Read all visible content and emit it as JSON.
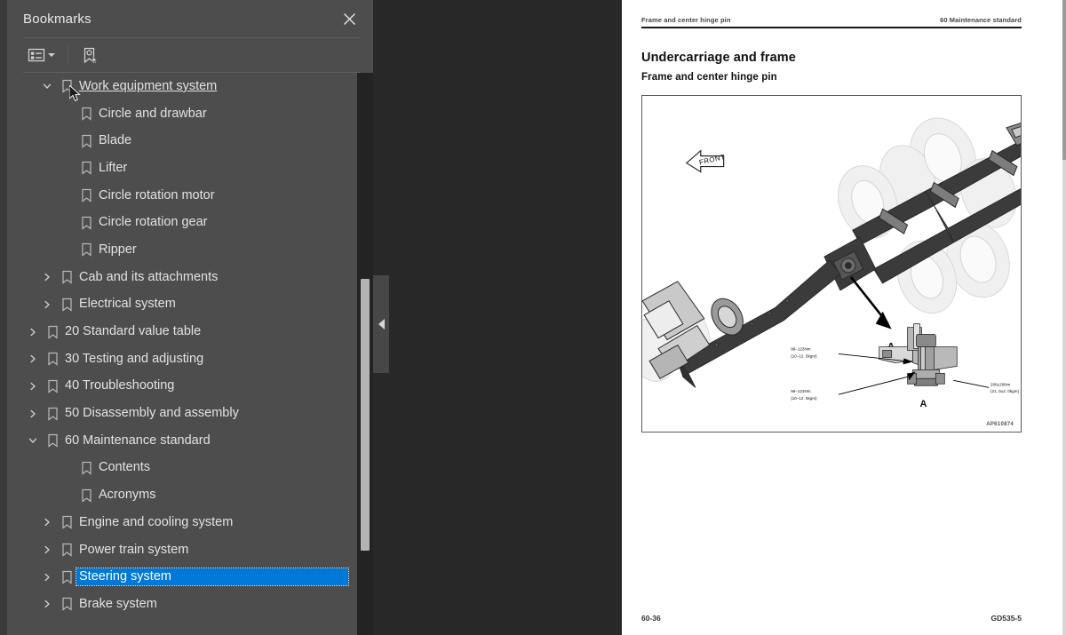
{
  "panel": {
    "title": "Bookmarks",
    "close_icon": "close-icon",
    "toolbar": {
      "options_icon": "list-options-icon",
      "options_caret": "chevron-down-icon",
      "new_bookmark_icon": "new-bookmark-icon"
    }
  },
  "tree": {
    "items": [
      {
        "label": "Work equipment system",
        "depth": 1,
        "twisty": "expanded",
        "bookmark": true,
        "state": "hovered"
      },
      {
        "label": "Circle and drawbar",
        "depth": 2,
        "twisty": "none",
        "bookmark": true,
        "state": "normal"
      },
      {
        "label": "Blade",
        "depth": 2,
        "twisty": "none",
        "bookmark": true,
        "state": "normal"
      },
      {
        "label": "Lifter",
        "depth": 2,
        "twisty": "none",
        "bookmark": true,
        "state": "normal"
      },
      {
        "label": "Circle rotation motor",
        "depth": 2,
        "twisty": "none",
        "bookmark": true,
        "state": "normal"
      },
      {
        "label": "Circle rotation gear",
        "depth": 2,
        "twisty": "none",
        "bookmark": true,
        "state": "normal"
      },
      {
        "label": "Ripper",
        "depth": 2,
        "twisty": "none",
        "bookmark": true,
        "state": "normal"
      },
      {
        "label": "Cab and its attachments",
        "depth": 1,
        "twisty": "collapsed",
        "bookmark": true,
        "state": "normal"
      },
      {
        "label": "Electrical system",
        "depth": 1,
        "twisty": "collapsed",
        "bookmark": true,
        "state": "normal"
      },
      {
        "label": "20 Standard value table",
        "depth": 0,
        "twisty": "collapsed",
        "bookmark": true,
        "state": "normal"
      },
      {
        "label": "30 Testing and adjusting",
        "depth": 0,
        "twisty": "collapsed",
        "bookmark": true,
        "state": "normal"
      },
      {
        "label": "40 Troubleshooting",
        "depth": 0,
        "twisty": "collapsed",
        "bookmark": true,
        "state": "normal"
      },
      {
        "label": "50 Disassembly and assembly",
        "depth": 0,
        "twisty": "collapsed",
        "bookmark": true,
        "state": "normal"
      },
      {
        "label": "60 Maintenance standard",
        "depth": 0,
        "twisty": "expanded",
        "bookmark": true,
        "state": "normal"
      },
      {
        "label": "Contents",
        "depth": 2,
        "twisty": "none",
        "bookmark": true,
        "state": "normal"
      },
      {
        "label": "Acronyms",
        "depth": 2,
        "twisty": "none",
        "bookmark": true,
        "state": "normal"
      },
      {
        "label": "Engine and cooling system",
        "depth": 1,
        "twisty": "collapsed",
        "bookmark": true,
        "state": "normal"
      },
      {
        "label": "Power train system",
        "depth": 1,
        "twisty": "collapsed",
        "bookmark": true,
        "state": "normal"
      },
      {
        "label": "Steering system",
        "depth": 1,
        "twisty": "collapsed",
        "bookmark": true,
        "state": "selected"
      },
      {
        "label": "Brake system",
        "depth": 1,
        "twisty": "collapsed",
        "bookmark": true,
        "state": "normal"
      }
    ],
    "selection_color": "#0078d7"
  },
  "collapse_handle": {
    "icon": "chevron-left-icon"
  },
  "document": {
    "header_left": "Frame and center hinge pin",
    "header_right": "60 Maintenance standard",
    "heading": "Undercarriage and frame",
    "subheading": "Frame and center hinge pin",
    "figure_id": "AP610874",
    "footer_left": "60-36",
    "footer_right": "GD535-5",
    "figure": {
      "front_label": "FRONT",
      "callout_main": "A",
      "callout_detail": "A",
      "annotations": [
        {
          "line1": "98–123Nm",
          "line2": "{10–12. 5kgm}"
        },
        {
          "line1": "98–123Nm",
          "line2": "{10–12. 5kgm}"
        },
        {
          "line1": "206±20Nm",
          "line2": "{21. 0±2. 0kgm}"
        }
      ]
    }
  }
}
